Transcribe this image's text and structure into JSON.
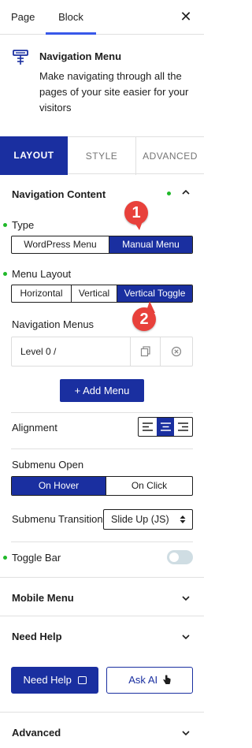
{
  "colors": {
    "accent": "#1a2fa0",
    "status_dot": "#1fb829",
    "badge": "#e8413b",
    "divider": "#e0e0e0"
  },
  "top_tabs": {
    "page": "Page",
    "block": "Block"
  },
  "close_icon": "close-icon",
  "block_card": {
    "icon": "navigation-menu-icon",
    "title": "Navigation Menu",
    "description": "Make navigating through all the pages of your site easier for your visitors"
  },
  "settings_tabs": {
    "layout": "LAYOUT",
    "style": "STYLE",
    "advanced": "ADVANCED"
  },
  "nav_content": {
    "title": "Navigation Content",
    "type_label": "Type",
    "type_options": [
      "WordPress Menu",
      "Manual Menu"
    ],
    "type_selected": "Manual Menu",
    "layout_label": "Menu Layout",
    "layout_options": [
      "Horizontal",
      "Vertical",
      "Vertical Toggle"
    ],
    "layout_selected": "Vertical Toggle",
    "menus_label": "Navigation Menus",
    "menu_items": [
      {
        "label": "Level 0 /"
      }
    ],
    "add_menu": "+ Add Menu",
    "alignment_label": "Alignment",
    "alignment_selected": "center",
    "submenu_open_label": "Submenu Open",
    "submenu_open_options": [
      "On Hover",
      "On Click"
    ],
    "submenu_open_selected": "On Hover",
    "submenu_transition_label": "Submenu Transition",
    "submenu_transition_value": "Slide Up (JS)",
    "toggle_bar_label": "Toggle Bar",
    "toggle_bar_on": false
  },
  "annotations": {
    "badge1": "1",
    "badge2": "2"
  },
  "panels": {
    "mobile_menu": "Mobile Menu",
    "need_help": "Need Help",
    "advanced": "Advanced"
  },
  "help": {
    "need_help_button": "Need Help",
    "ask_ai_button": "Ask AI"
  }
}
